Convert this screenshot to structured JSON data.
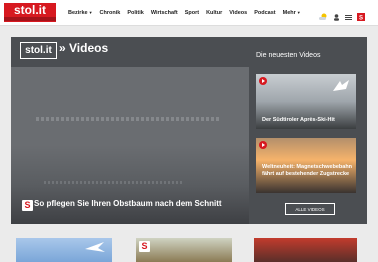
{
  "header": {
    "logo_text": "stol.it",
    "nav": [
      {
        "label": "Bezirke",
        "dropdown": true
      },
      {
        "label": "Chronik"
      },
      {
        "label": "Politik"
      },
      {
        "label": "Wirtschaft"
      },
      {
        "label": "Sport"
      },
      {
        "label": "Kultur"
      },
      {
        "label": "Videos"
      },
      {
        "label": "Podcast"
      },
      {
        "label": "Mehr",
        "dropdown": true
      }
    ],
    "icons": [
      "weather-icon",
      "user-icon",
      "menu-icon",
      "s-logo-icon"
    ]
  },
  "videos": {
    "section_logo": "stol.it",
    "section_title": "» Videos",
    "main_caption": "So pflegen Sie Ihren Obstbaum nach dem Schnitt",
    "sidebar_title": "Die neuesten Videos",
    "items": [
      {
        "caption": "Der Südtiroler Après-Ski-Hit"
      },
      {
        "caption": "Weltneuheit: Magnetschwebebahn fährt auf bestehender Zugstrecke"
      }
    ],
    "all_button": "ALLE VIDEOS"
  },
  "colors": {
    "brand": "#d71920",
    "panel": "#4b4e52"
  }
}
